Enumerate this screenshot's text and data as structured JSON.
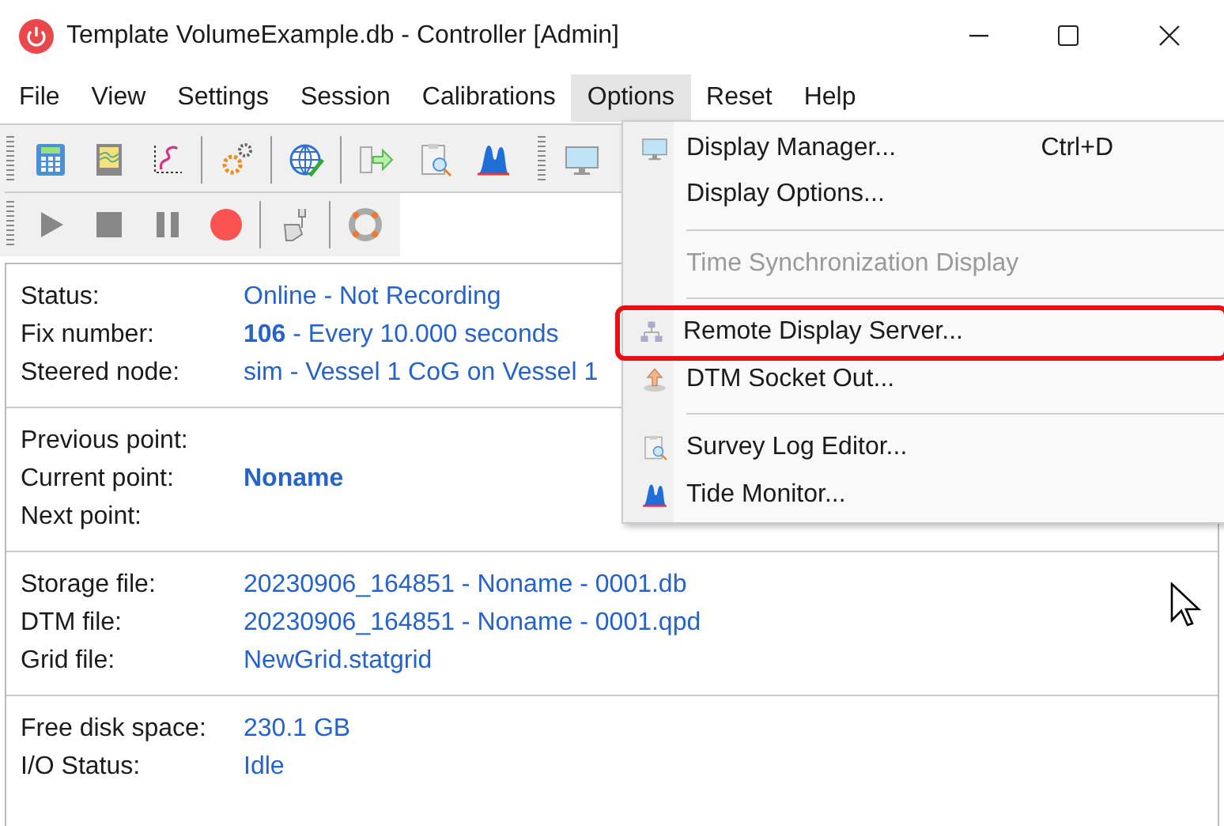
{
  "window": {
    "title": "Template VolumeExample.db - Controller [Admin]"
  },
  "menu_bar": [
    {
      "label": "File",
      "selected": false
    },
    {
      "label": "View",
      "selected": false
    },
    {
      "label": "Settings",
      "selected": false
    },
    {
      "label": "Session",
      "selected": false
    },
    {
      "label": "Calibrations",
      "selected": false
    },
    {
      "label": "Options",
      "selected": true
    },
    {
      "label": "Reset",
      "selected": false
    },
    {
      "label": "Help",
      "selected": false
    }
  ],
  "toolbar_1": [
    {
      "kind": "button"
    },
    {
      "kind": "button"
    },
    {
      "kind": "button"
    },
    {
      "kind": "separator"
    },
    {
      "kind": "button"
    },
    {
      "kind": "separator"
    },
    {
      "kind": "button"
    },
    {
      "kind": "separator"
    },
    {
      "kind": "button"
    },
    {
      "kind": "button"
    },
    {
      "kind": "button"
    }
  ],
  "toolbar_2": [
    {
      "kind": "button"
    },
    {
      "kind": "button"
    },
    {
      "kind": "button"
    },
    {
      "kind": "button"
    },
    {
      "kind": "separator"
    },
    {
      "kind": "button"
    },
    {
      "kind": "separator"
    },
    {
      "kind": "button"
    }
  ],
  "info_sections": [
    [
      {
        "label": "Status:",
        "value": "Online - Not Recording"
      },
      {
        "label": "Fix number:",
        "value": "**106** - Every 10.000 seconds"
      },
      {
        "label": "Steered node:",
        "value": "sim - Vessel 1 CoG on Vessel 1"
      }
    ],
    [
      {
        "label": "Previous point:"
      },
      {
        "label": "Current point:",
        "value": "Noname",
        "bold": true
      },
      {
        "label": "Next point:"
      }
    ],
    [
      {
        "label": "Storage file:",
        "value": "20230906_164851 - Noname - 0001.db"
      },
      {
        "label": "DTM file:",
        "value": "20230906_164851 - Noname - 0001.qpd"
      },
      {
        "label": "Grid file:",
        "value": "NewGrid.statgrid"
      }
    ],
    [
      {
        "label": "Free disk space:",
        "value": "230.1 GB"
      },
      {
        "label": "I/O Status:",
        "value": "Idle"
      }
    ]
  ],
  "options_menu": [
    {
      "kind": "item",
      "label": "Display Manager...",
      "shortcut": "Ctrl+D",
      "disabled": false,
      "highlighted": false
    },
    {
      "kind": "item",
      "label": "Display Options...",
      "disabled": false,
      "highlighted": false
    },
    {
      "kind": "separator"
    },
    {
      "kind": "item",
      "label": "Time Synchronization Display",
      "disabled": true,
      "highlighted": false
    },
    {
      "kind": "separator"
    },
    {
      "kind": "item",
      "label": "Remote Display Server...",
      "disabled": false,
      "highlighted": true
    },
    {
      "kind": "item",
      "label": "DTM Socket Out...",
      "disabled": false,
      "highlighted": false
    },
    {
      "kind": "separator"
    },
    {
      "kind": "item",
      "label": "Survey Log Editor...",
      "disabled": false,
      "highlighted": false
    },
    {
      "kind": "item",
      "label": "Tide Monitor...",
      "disabled": false,
      "highlighted": false
    }
  ]
}
